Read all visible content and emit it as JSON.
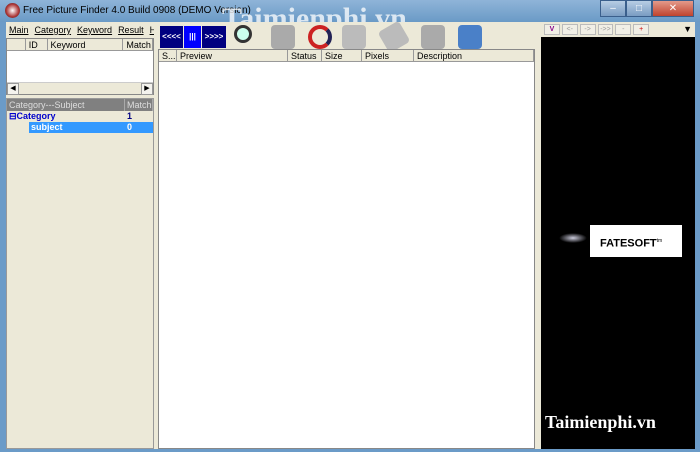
{
  "window": {
    "title": "Free Picture Finder 4.0 Build 0908  (DEMO Version)",
    "minimize": "–",
    "maximize": "□",
    "close": "✕"
  },
  "watermark": "Taimienphi.vn",
  "menu": [
    "Main",
    "Category",
    "Keyword",
    "Result",
    "He"
  ],
  "keyword_grid": {
    "columns": [
      "",
      "ID",
      "Keyword",
      "Match"
    ]
  },
  "category_tree": {
    "columns": [
      "Category---Subject",
      "Match"
    ],
    "rows": [
      {
        "name": "Category",
        "match": "1"
      },
      {
        "name": "subject",
        "match": "0",
        "selected": true
      }
    ]
  },
  "toolbar": {
    "prev": "<<<<",
    "pause": "|||",
    "next": ">>>>",
    "icons": [
      "search-icon",
      "stop-icon",
      "refresh-icon",
      "puzzle-icon",
      "tag-icon",
      "network-icon",
      "settings-icon"
    ]
  },
  "results": {
    "columns": [
      "S...",
      "Preview",
      "Status",
      "Size",
      "Pixels",
      "Description"
    ]
  },
  "viewer_toolbar": {
    "buttons": [
      "V",
      "<-",
      "->",
      "->>",
      "-",
      "+"
    ],
    "dropdown": "▼"
  },
  "viewer": {
    "logo": "FATESOFT",
    "tm": "tm"
  },
  "colors": {
    "accent": "#000080",
    "selected": "#3399ff",
    "tree_text": "#0000cc"
  }
}
